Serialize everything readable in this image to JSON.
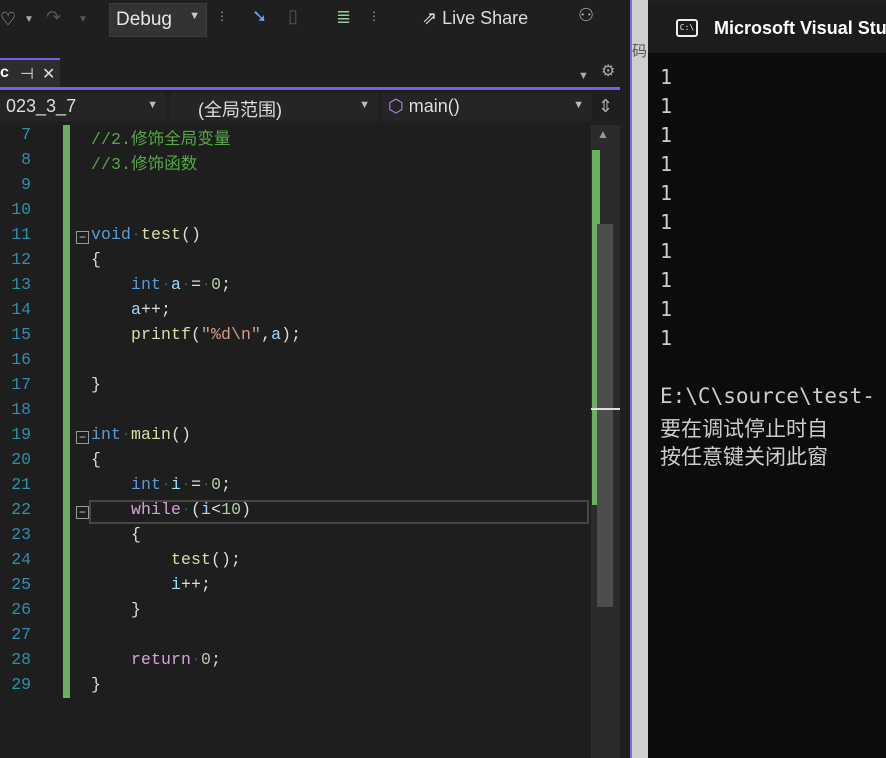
{
  "toolbar": {
    "config": "Debug",
    "live_share": "Live Share"
  },
  "tab": {
    "name_partial": "c",
    "pin": "⊣",
    "close": "✕"
  },
  "navbar": {
    "project": "023_3_7",
    "scope": "(全局范围)",
    "member": "main()"
  },
  "editor": {
    "lines": [
      {
        "n": "7",
        "t": [
          [
            "//2.修饰全局变量",
            "cm"
          ]
        ]
      },
      {
        "n": "8",
        "t": [
          [
            "//3.修饰函数",
            "cm"
          ]
        ]
      },
      {
        "n": "9",
        "t": []
      },
      {
        "n": "10",
        "t": []
      },
      {
        "n": "11",
        "t": [
          [
            "void",
            "kw"
          ],
          [
            "·",
            "ws"
          ],
          [
            "test",
            "fn"
          ],
          [
            "()",
            ""
          ]
        ],
        "fold": true
      },
      {
        "n": "12",
        "t": [
          [
            "{",
            ""
          ]
        ]
      },
      {
        "n": "13",
        "t": [
          [
            "    ",
            ""
          ],
          [
            "int",
            "kw"
          ],
          [
            "·",
            "ws"
          ],
          [
            "a",
            "var"
          ],
          [
            "·",
            "ws"
          ],
          [
            "=",
            ""
          ],
          [
            "·",
            "ws"
          ],
          [
            "0",
            "num"
          ],
          [
            ";",
            ""
          ]
        ]
      },
      {
        "n": "14",
        "t": [
          [
            "    ",
            ""
          ],
          [
            "a",
            "var"
          ],
          [
            "++;",
            ""
          ]
        ]
      },
      {
        "n": "15",
        "t": [
          [
            "    ",
            ""
          ],
          [
            "printf",
            "fn"
          ],
          [
            "(",
            ""
          ],
          [
            "\"%d\\n\"",
            "str"
          ],
          [
            ",",
            ""
          ],
          [
            "a",
            "var"
          ],
          [
            ");",
            ""
          ]
        ]
      },
      {
        "n": "16",
        "t": []
      },
      {
        "n": "17",
        "t": [
          [
            "}",
            ""
          ]
        ]
      },
      {
        "n": "18",
        "t": []
      },
      {
        "n": "19",
        "t": [
          [
            "int",
            "kw"
          ],
          [
            "·",
            "ws"
          ],
          [
            "main",
            "fn"
          ],
          [
            "()",
            ""
          ]
        ],
        "fold": true
      },
      {
        "n": "20",
        "t": [
          [
            "{",
            ""
          ]
        ]
      },
      {
        "n": "21",
        "t": [
          [
            "    ",
            ""
          ],
          [
            "int",
            "kw"
          ],
          [
            "·",
            "ws"
          ],
          [
            "i",
            "var"
          ],
          [
            "·",
            "ws"
          ],
          [
            "=",
            ""
          ],
          [
            "·",
            "ws"
          ],
          [
            "0",
            "num"
          ],
          [
            ";",
            ""
          ]
        ]
      },
      {
        "n": "22",
        "t": [
          [
            "    ",
            ""
          ],
          [
            "while",
            "ctl"
          ],
          [
            "·",
            "ws"
          ],
          [
            "(",
            ""
          ],
          [
            "i",
            "var"
          ],
          [
            "<",
            ""
          ],
          [
            "10",
            "num"
          ],
          [
            ")",
            ""
          ]
        ],
        "fold": true
      },
      {
        "n": "23",
        "t": [
          [
            "    {",
            ""
          ]
        ]
      },
      {
        "n": "24",
        "t": [
          [
            "        ",
            ""
          ],
          [
            "test",
            "fn"
          ],
          [
            "();",
            ""
          ]
        ]
      },
      {
        "n": "25",
        "t": [
          [
            "        ",
            ""
          ],
          [
            "i",
            "var"
          ],
          [
            "++;",
            ""
          ]
        ]
      },
      {
        "n": "26",
        "t": [
          [
            "    }",
            ""
          ]
        ]
      },
      {
        "n": "27",
        "t": []
      },
      {
        "n": "28",
        "t": [
          [
            "    ",
            ""
          ],
          [
            "return",
            "ctl"
          ],
          [
            "·",
            "ws"
          ],
          [
            "0",
            "num"
          ],
          [
            ";",
            ""
          ]
        ]
      },
      {
        "n": "29",
        "t": [
          [
            "}",
            ""
          ]
        ]
      }
    ]
  },
  "console": {
    "title": "Microsoft Visual Stud",
    "icon": "C:\\",
    "output": [
      "1",
      "1",
      "1",
      "1",
      "1",
      "1",
      "1",
      "1",
      "1",
      "1"
    ],
    "footer": [
      "E:\\C\\source\\test-",
      "要在调试停止时自",
      "按任意键关闭此窗"
    ]
  },
  "side_partial": {
    "a": "</",
    "b": "码"
  },
  "colors": {
    "accent": "#7160e8",
    "change_bar": "#6ab15f",
    "keyword": "#569cd6",
    "comment": "#57a64a"
  }
}
